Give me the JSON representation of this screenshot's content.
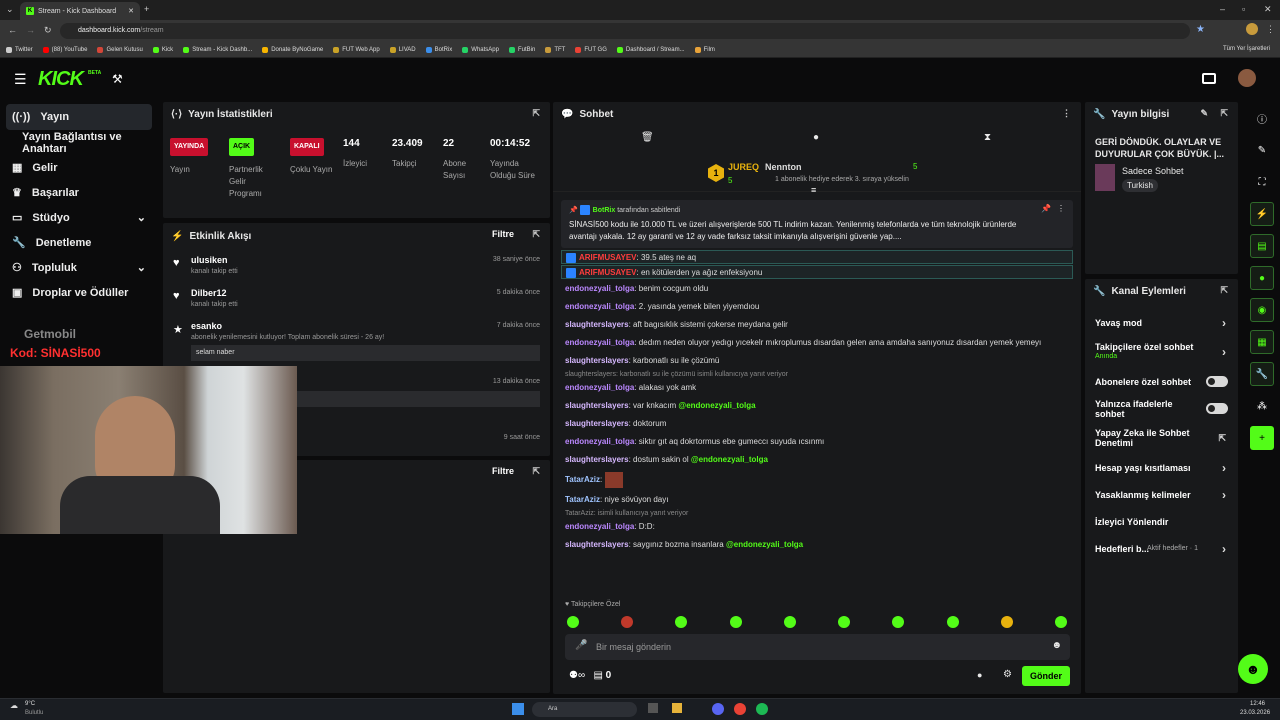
{
  "browser": {
    "tab_title": "Stream - Kick Dashboard",
    "url_host": "dashboard.kick.com",
    "url_path": "/stream",
    "bookmarks": [
      "Twitter",
      "(88) YouTube",
      "Gelen Kutusu",
      "Kick",
      "Stream - Kick Dashb...",
      "Donate ByNoGame",
      "FUT Web App",
      "LIVAD",
      "BotRix",
      "WhatsApp",
      "FutBin",
      "TFT",
      "FUT GG",
      "Dashboard / Stream...",
      "Film"
    ],
    "all_bookmarks": "Tüm Yer İşaretleri"
  },
  "brand": {
    "logo": "KICK",
    "beta": "BETA"
  },
  "sidebar": {
    "items": [
      {
        "label": "Yayın"
      },
      {
        "label": "Yayın Bağlantısı ve Anahtarı"
      },
      {
        "label": "Gelir"
      },
      {
        "label": "Başarılar"
      },
      {
        "label": "Stüdyo"
      },
      {
        "label": "Denetleme"
      },
      {
        "label": "Topluluk"
      },
      {
        "label": "Droplar ve Ödüller"
      }
    ],
    "overlay_brand": "Getmobil",
    "overlay_code": "Kod: SİNASİ500"
  },
  "stats": {
    "title": "Yayın İstatistikleri",
    "columns": [
      {
        "badge": "YAYINDA",
        "label": "Yayın"
      },
      {
        "badge": "AÇIK",
        "label": "Partnerlik Gelir Programı"
      },
      {
        "badge": "KAPALI",
        "label": "Çoklu Yayın"
      },
      {
        "value": "144",
        "label": "İzleyici"
      },
      {
        "value": "23.409",
        "label": "Takipçi"
      },
      {
        "value": "22",
        "label": "Abone Sayısı"
      },
      {
        "value": "00:14:52",
        "label": "Yayında Olduğu Süre"
      }
    ]
  },
  "activity": {
    "title": "Etkinlik Akışı",
    "filter": "Filtre",
    "events": [
      {
        "name": "ulusiken",
        "sub": "kanalı takip etti",
        "time": "38 saniye önce"
      },
      {
        "name": "Dilber12",
        "sub": "kanalı takip etti",
        "time": "5 dakika önce"
      },
      {
        "name": "esanko",
        "sub": "abonelik yenilemesini kutluyor! Toplam abonelik süresi - 26 ay!",
        "time": "7 dakika önce",
        "quote": "selam naber"
      },
      {
        "name": "",
        "sub": "r! Toplam abonelik süresi - 2 ay!",
        "time": "13 dakika önce",
        "quote": "na"
      },
      {
        "name": "",
        "sub": "",
        "time": "9 saat önce"
      }
    ]
  },
  "panel3": {
    "filter": "Filtre"
  },
  "chat": {
    "title": "Sohbet",
    "top_gifters": [
      {
        "name": "JUREQ",
        "count": "5"
      },
      {
        "name": "Nennton",
        "count": "5",
        "note": "1 abonelik hediye ederek 3. sıraya yükselin"
      }
    ],
    "pinned_by": "BotRix",
    "pinned_suffix": "tarafından sabitlendi",
    "pinned_text": "SİNASİ500 kodu ile 10.000 TL ve üzeri alışverişlerde 500 TL indirim kazan.  Yenilenmiş telefonlarda ve tüm teknolojik ürünlerde avantajı yakala. 12 ay garanti ve 12 ay vade farksız taksit imkanıyla alışverişini güvenle yap....",
    "messages": [
      {
        "user": "ARIFMUSAYEV",
        "text": ": 39.5 ateş ne aq",
        "hl": true
      },
      {
        "user": "ARIFMUSAYEV",
        "text": ": en kötülerden ya ağız enfeksiyonu",
        "hl": true
      },
      {
        "user": "endonezyali_tolga",
        "text": ": benim cocgum oldu"
      },
      {
        "user": "endonezyali_tolga",
        "text": ": 2. yasında yemek bilen yiyemdıou"
      },
      {
        "user": "slaughterslayers",
        "text": ": aft bagısıklık sistemi çokerse meydana gelir"
      },
      {
        "user": "endonezyali_tolga",
        "text": ": dedım neden oluyor yedıgı yıcekelr mıkroplumus dısardan gelen ama amdaha sanıyonuz dısardan yemek yemeyı"
      },
      {
        "user": "slaughterslayers",
        "text": ": karbonatlı su ile çözümü"
      },
      {
        "reply": "slaughterslayers: karbonatlı su ile çözümü isimli kullanıcıya yanıt veriyor"
      },
      {
        "user": "endonezyali_tolga",
        "text": ": alakası yok amk"
      },
      {
        "user": "slaughterslayers",
        "text": ": var knkacım ",
        "mention": "@endonezyali_tolga"
      },
      {
        "user": "slaughterslayers",
        "text": ": doktorum"
      },
      {
        "user": "endonezyali_tolga",
        "text": ": siktır gıt aq dokrtormus ebe gumeccı suyuda ıcsınmı"
      },
      {
        "user": "slaughterslayers",
        "text": ": dostum sakin ol ",
        "mention": "@endonezyali_tolga"
      },
      {
        "user": "TatarAziz",
        "text": ":",
        "emote": true
      },
      {
        "user": "TatarAziz",
        "text": ": niye sövüyon dayı"
      },
      {
        "reply": "TatarAziz:     isimli kullanıcıya yanıt veriyor"
      },
      {
        "user": "endonezyali_tolga",
        "text": ": D:D:"
      },
      {
        "user": "slaughterslayers",
        "text": ": saygınız bozma insanlara ",
        "mention": "@endonezyali_tolga"
      }
    ],
    "followers_only": "Takipçilere Özel",
    "input_placeholder": "Bir mesaj gönderin",
    "points": "0",
    "send": "Gönder"
  },
  "stream_info": {
    "title": "Yayın bilgisi",
    "stream_title": "GERİ DÖNDÜK. OLAYLAR VE DUYURULAR ÇOK BÜYÜK. |...",
    "category": "Sadece Sohbet",
    "tag": "Turkish"
  },
  "channel_actions": {
    "title": "Kanal Eylemleri",
    "items": [
      {
        "label": "Yavaş mod",
        "kind": "arrow"
      },
      {
        "label": "Takipçilere özel sohbet",
        "sub": "Anında",
        "kind": "arrow"
      },
      {
        "label": "Abonelere özel sohbet",
        "kind": "toggle"
      },
      {
        "label": "Yalnızca ifadelerle sohbet",
        "kind": "toggle"
      },
      {
        "label": "Yapay Zeka ile Sohbet Denetimi",
        "kind": "ext"
      },
      {
        "label": "Hesap yaşı kısıtlaması",
        "kind": "arrow"
      },
      {
        "label": "Yasaklanmış kelimeler",
        "kind": "arrow"
      },
      {
        "label": "İzleyici Yönlendir",
        "kind": "none"
      },
      {
        "label": "Hedefleri b...",
        "sub": "Aktif hedefler · 1",
        "kind": "arrow"
      }
    ]
  },
  "taskbar": {
    "weather_temp": "9°C",
    "weather_desc": "Bulutlu",
    "search": "Ara",
    "time": "12:46",
    "date": "23.03.2026"
  },
  "colors": {
    "accent": "#53fc18",
    "panel": "#18191b",
    "bg": "#0b0b0c",
    "live_red": "#e4002b"
  }
}
